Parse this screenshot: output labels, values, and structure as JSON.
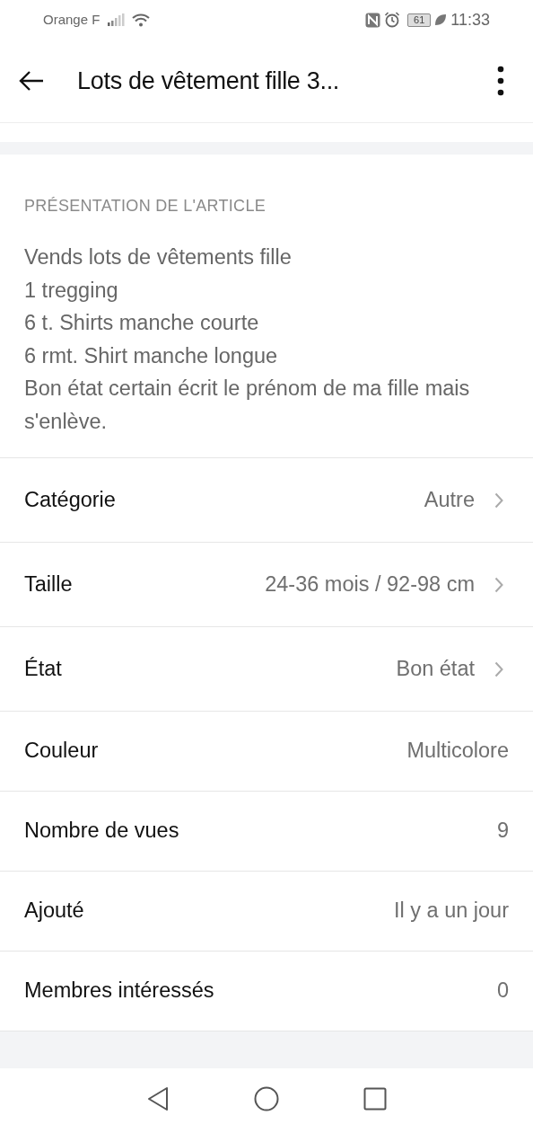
{
  "status_bar": {
    "carrier": "Orange F",
    "battery": "61",
    "time": "11:33"
  },
  "app_bar": {
    "title": "Lots de vêtement fille 3..."
  },
  "section": {
    "heading": "PRÉSENTATION DE L'ARTICLE",
    "description": [
      "Vends lots de vêtements fille",
      "1 tregging",
      "6 t. Shirts manche courte",
      "6 rmt. Shirt manche longue",
      "Bon état certain écrit le prénom de ma fille mais s'enlève."
    ]
  },
  "details": [
    {
      "label": "Catégorie",
      "value": "Autre",
      "chevron": true
    },
    {
      "label": "Taille",
      "value": "24-36 mois / 92-98 cm",
      "chevron": true
    },
    {
      "label": "État",
      "value": "Bon état",
      "chevron": true
    },
    {
      "label": "Couleur",
      "value": "Multicolore",
      "chevron": false
    },
    {
      "label": "Nombre de vues",
      "value": "9",
      "chevron": false
    },
    {
      "label": "Ajouté",
      "value": "Il y a un jour",
      "chevron": false
    },
    {
      "label": "Membres intéressés",
      "value": "0",
      "chevron": false
    }
  ]
}
